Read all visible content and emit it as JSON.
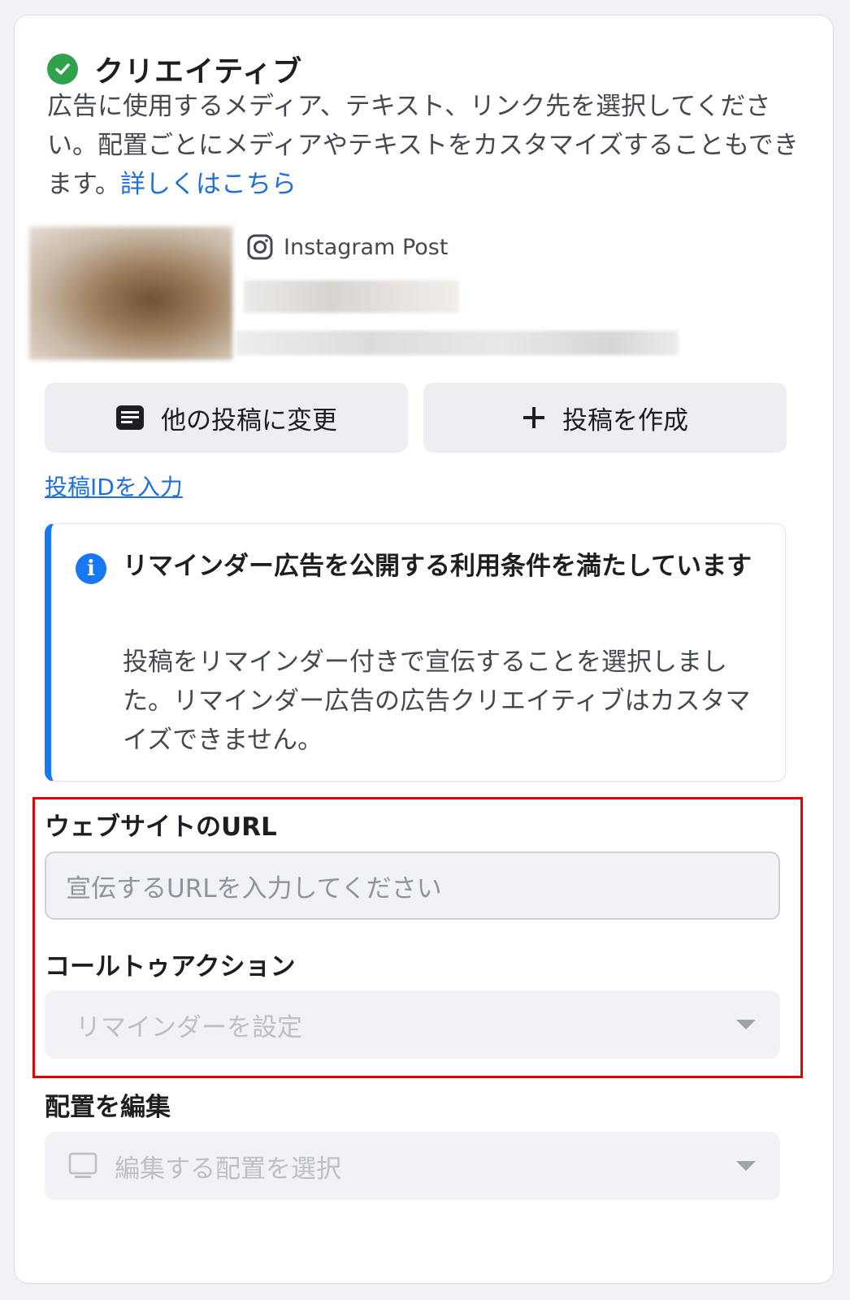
{
  "creative": {
    "title": "クリエイティブ",
    "description": "広告に使用するメディア、テキスト、リンク先を選択してください。配置ごとにメディアやテキストをカスタマイズすることもできます。",
    "learn_more_link": "詳しくはこちら"
  },
  "post": {
    "source_label": "Instagram Post"
  },
  "buttons": {
    "change_post": "他の投稿に変更",
    "create_post": "投稿を作成"
  },
  "links": {
    "enter_post_id": "投稿IDを入力"
  },
  "notice": {
    "title": "リマインダー広告を公開する利用条件を満たしています",
    "body": "投稿をリマインダー付きで宣伝することを選択しました。リマインダー広告の広告クリエイティブはカスタマイズできません。"
  },
  "website_url": {
    "label": "ウェブサイトのURL",
    "placeholder": "宣伝するURLを入力してください",
    "value": ""
  },
  "call_to_action": {
    "label": "コールトゥアクション",
    "selected": "リマインダーを設定"
  },
  "placement": {
    "label": "配置を編集",
    "selected": "編集する配置を選択"
  },
  "colors": {
    "accent_blue": "#1877f2",
    "link_blue": "#216fdb",
    "success_green": "#31a24c",
    "highlight_red": "#e30000"
  },
  "icons": {
    "status": "check-circle-icon",
    "source": "instagram-icon",
    "change": "post-icon",
    "create": "plus-icon",
    "info": "info-icon",
    "placement": "device-icon",
    "dropdown": "caret-down-icon"
  }
}
